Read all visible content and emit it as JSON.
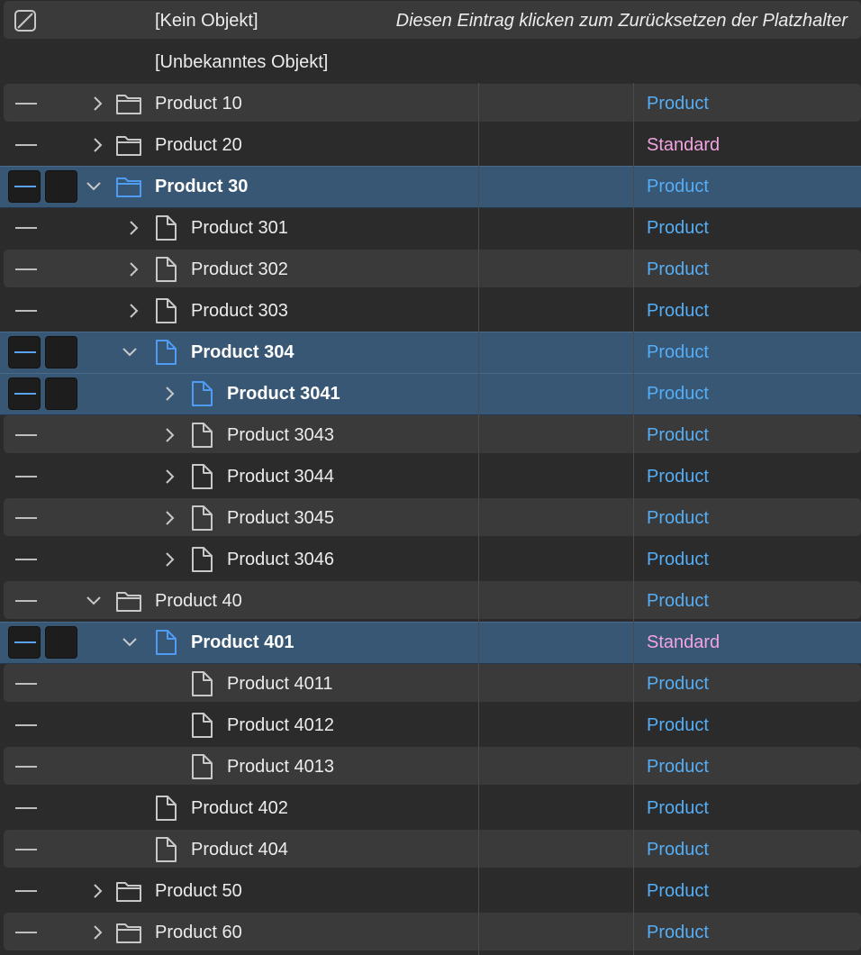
{
  "header": {
    "no_object_label": "[Kein Objekt]",
    "reset_hint": "Diesen Eintrag klicken zum Zurücksetzen der Platzhalter",
    "unknown_object_label": "[Unbekanntes Objekt]"
  },
  "colors": {
    "product": "#55aef5",
    "standard": "#f2a4e0",
    "selection": "#385775",
    "selected_icon": "#4f9cf5"
  },
  "rows": [
    {
      "label": "Product 10",
      "type": "Product",
      "depth": 0,
      "kind": "folder",
      "chevron": "right",
      "selected": false
    },
    {
      "label": "Product 20",
      "type": "Standard",
      "depth": 0,
      "kind": "folder",
      "chevron": "right",
      "selected": false
    },
    {
      "label": "Product 30",
      "type": "Product",
      "depth": 0,
      "kind": "folder",
      "chevron": "down",
      "selected": true
    },
    {
      "label": "Product 301",
      "type": "Product",
      "depth": 1,
      "kind": "doc",
      "chevron": "right",
      "selected": false
    },
    {
      "label": "Product 302",
      "type": "Product",
      "depth": 1,
      "kind": "doc",
      "chevron": "right",
      "selected": false
    },
    {
      "label": "Product 303",
      "type": "Product",
      "depth": 1,
      "kind": "doc",
      "chevron": "right",
      "selected": false
    },
    {
      "label": "Product 304",
      "type": "Product",
      "depth": 1,
      "kind": "doc",
      "chevron": "down",
      "selected": true
    },
    {
      "label": "Product 3041",
      "type": "Product",
      "depth": 2,
      "kind": "doc",
      "chevron": "right",
      "selected": true
    },
    {
      "label": "Product 3043",
      "type": "Product",
      "depth": 2,
      "kind": "doc",
      "chevron": "right",
      "selected": false
    },
    {
      "label": "Product 3044",
      "type": "Product",
      "depth": 2,
      "kind": "doc",
      "chevron": "right",
      "selected": false
    },
    {
      "label": "Product 3045",
      "type": "Product",
      "depth": 2,
      "kind": "doc",
      "chevron": "right",
      "selected": false
    },
    {
      "label": "Product 3046",
      "type": "Product",
      "depth": 2,
      "kind": "doc",
      "chevron": "right",
      "selected": false
    },
    {
      "label": "Product 40",
      "type": "Product",
      "depth": 0,
      "kind": "folder",
      "chevron": "down",
      "selected": false
    },
    {
      "label": "Product 401",
      "type": "Standard",
      "depth": 1,
      "kind": "doc",
      "chevron": "down",
      "selected": true
    },
    {
      "label": "Product 4011",
      "type": "Product",
      "depth": 2,
      "kind": "doc",
      "chevron": "none",
      "selected": false
    },
    {
      "label": "Product 4012",
      "type": "Product",
      "depth": 2,
      "kind": "doc",
      "chevron": "none",
      "selected": false
    },
    {
      "label": "Product 4013",
      "type": "Product",
      "depth": 2,
      "kind": "doc",
      "chevron": "none",
      "selected": false
    },
    {
      "label": "Product 402",
      "type": "Product",
      "depth": 1,
      "kind": "doc",
      "chevron": "none",
      "selected": false
    },
    {
      "label": "Product 404",
      "type": "Product",
      "depth": 1,
      "kind": "doc",
      "chevron": "none",
      "selected": false
    },
    {
      "label": "Product 50",
      "type": "Product",
      "depth": 0,
      "kind": "folder",
      "chevron": "right",
      "selected": false
    },
    {
      "label": "Product 60",
      "type": "Product",
      "depth": 0,
      "kind": "folder",
      "chevron": "right",
      "selected": false
    }
  ]
}
